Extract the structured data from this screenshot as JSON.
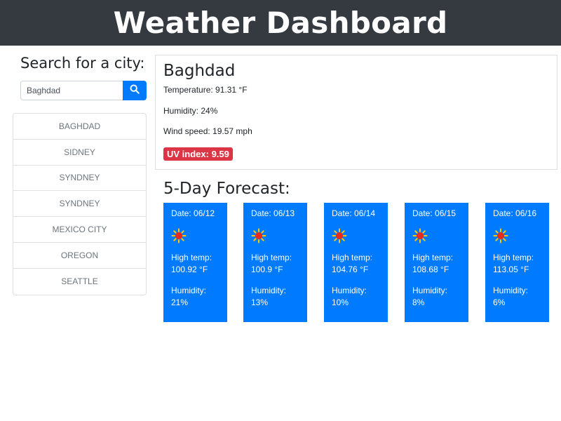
{
  "header": {
    "title": "Weather Dashboard"
  },
  "sidebar": {
    "search_heading": "Search for a city:",
    "search_value": "Baghdad",
    "search_icon": "search-icon",
    "history": [
      "BAGHDAD",
      "SIDNEY",
      "SYNDNEY",
      "SYNDNEY",
      "MEXICO CITY",
      "OREGON",
      "SEATTLE"
    ]
  },
  "current": {
    "city": "Baghdad",
    "temperature": "Temperature: 91.31 °F",
    "humidity": "Humidity: 24%",
    "wind": "Wind speed: 19.57 mph",
    "uv": "UV index: 9.59"
  },
  "forecast": {
    "heading": "5-Day Forecast:",
    "days": [
      {
        "date": "Date: 06/12",
        "icon": "sun-icon",
        "high_label": "High temp:",
        "high": "100.92 °F",
        "humidity_label": "Humidity:",
        "humidity": "21%"
      },
      {
        "date": "Date: 06/13",
        "icon": "sun-icon",
        "high_label": "High temp:",
        "high": "100.9 °F",
        "humidity_label": "Humidity:",
        "humidity": "13%"
      },
      {
        "date": "Date: 06/14",
        "icon": "sun-icon",
        "high_label": "High temp:",
        "high": "104.76 °F",
        "humidity_label": "Humidity:",
        "humidity": "10%"
      },
      {
        "date": "Date: 06/15",
        "icon": "sun-icon",
        "high_label": "High temp:",
        "high": "108.68 °F",
        "humidity_label": "Humidity:",
        "humidity": "8%"
      },
      {
        "date": "Date: 06/16",
        "icon": "sun-icon",
        "high_label": "High temp:",
        "high": "113.05 °F",
        "humidity_label": "Humidity:",
        "humidity": "6%"
      }
    ]
  },
  "colors": {
    "header_bg": "#343a40",
    "accent": "#007bff",
    "uv_badge": "#dc3545"
  }
}
